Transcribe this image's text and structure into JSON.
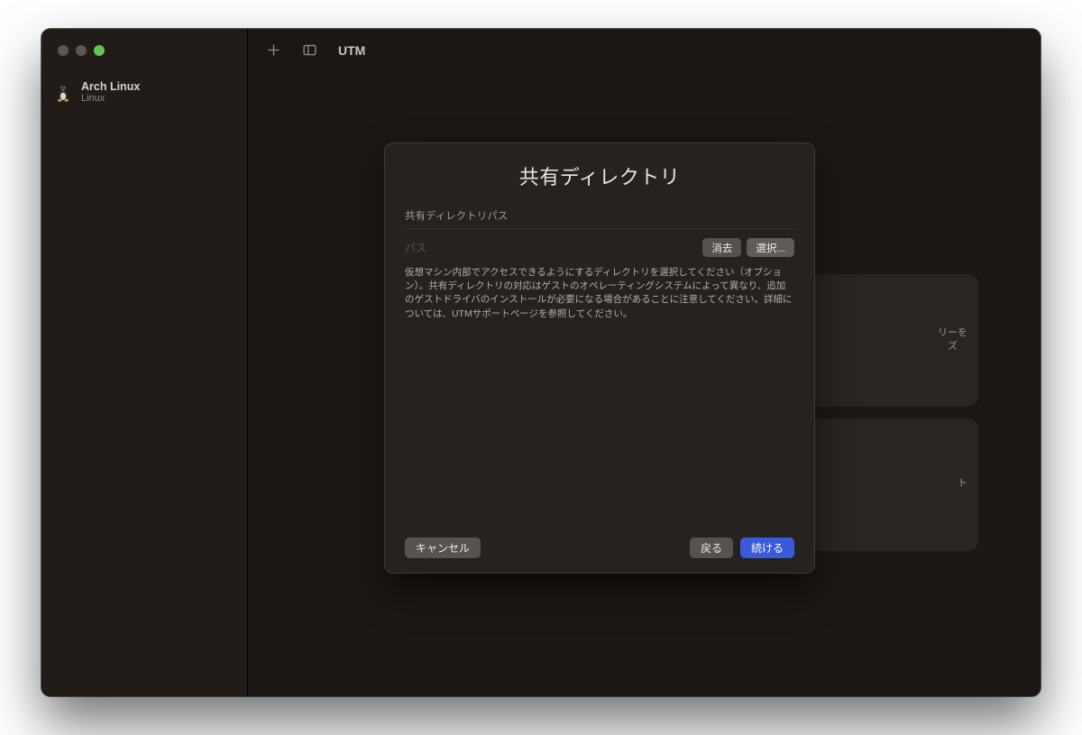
{
  "window": {
    "app_title": "UTM"
  },
  "sidebar": {
    "vm": {
      "name": "Arch Linux",
      "os": "Linux",
      "icon": "linux-tux-icon"
    }
  },
  "toolbar": {
    "add_icon": "plus-icon",
    "sidebar_toggle_icon": "sidebar-toggle-icon"
  },
  "background_cards": {
    "card1": {
      "line1": "リーを",
      "line2": "ズ"
    },
    "card2": {
      "line1": "ト"
    }
  },
  "dialog": {
    "title": "共有ディレクトリ",
    "section_label": "共有ディレクトリパス",
    "path_placeholder": "パス",
    "clear_button": "消去",
    "choose_button": "選択...",
    "description": "仮想マシン内部でアクセスできるようにするディレクトリを選択してください（オプション）。共有ディレクトリの対応はゲストのオペレーティングシステムによって異なり、追加のゲストドライバのインストールが必要になる場合があることに注意してください。詳細については、UTMサポートページを参照してください。",
    "cancel_button": "キャンセル",
    "back_button": "戻る",
    "continue_button": "続ける"
  }
}
